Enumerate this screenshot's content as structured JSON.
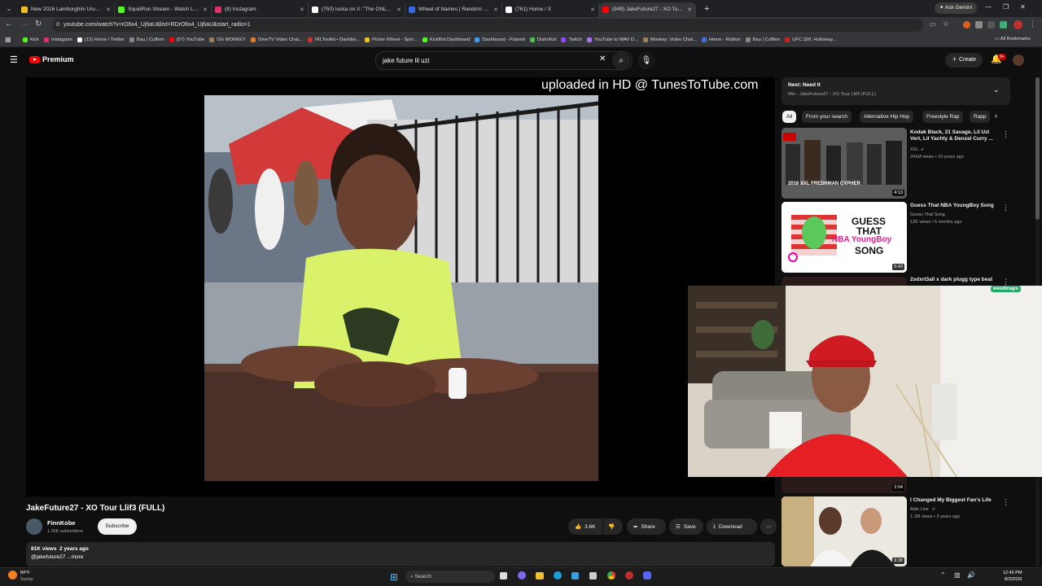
{
  "browser": {
    "tabs": [
      {
        "label": "New 2026 Lamborghini Urus S",
        "color": "#f0c020"
      },
      {
        "label": "SquidRon Stream - Watch Live",
        "color": "#53fc18"
      },
      {
        "label": "(8) Instagram",
        "color": "#e1306c"
      },
      {
        "label": "(750) lucka on X: \"The ONLY th",
        "color": "#ffffff"
      },
      {
        "label": "Wheel of Names | Random nam",
        "color": "#3369e8"
      },
      {
        "label": "(761) Home / X",
        "color": "#ffffff"
      },
      {
        "label": "(949) JakeFuture27 - XO Tour Ll",
        "color": "#ff0000"
      }
    ],
    "new_tab": "+",
    "ask_gemini": "Ask Gemini",
    "url": "youtube.com/watch?v=rO6x4_Uj6aU&list=RDrO6x4_Uj6aU&start_radio=1",
    "bookmarks": [
      {
        "label": "Kick",
        "color": "#53fc18"
      },
      {
        "label": "Instagram",
        "color": "#e1306c"
      },
      {
        "label": "(12) Home / Twitter",
        "color": "#ffffff"
      },
      {
        "label": "Bau | Cuffem",
        "color": "#888888"
      },
      {
        "label": "(57) YouTube",
        "color": "#ff0000"
      },
      {
        "label": "OG MONKEY",
        "color": "#a0805a"
      },
      {
        "label": "OmeTV Video Chat...",
        "color": "#e08030"
      },
      {
        "label": "IRLToolkit • Dashbo...",
        "color": "#cc3333"
      },
      {
        "label": "Picker Wheel - Spin...",
        "color": "#f0c020"
      },
      {
        "label": "KickBot Dashboard",
        "color": "#53fc18"
      },
      {
        "label": "Dashboard - Pulsoid",
        "color": "#40a0f0"
      },
      {
        "label": "DistroKid",
        "color": "#50c050"
      },
      {
        "label": "Twitch",
        "color": "#9146ff"
      },
      {
        "label": "YouTube to WAV D...",
        "color": "#b070f0"
      },
      {
        "label": "Monkey: Video Chat...",
        "color": "#a0805a"
      },
      {
        "label": "Home - Roblox",
        "color": "#4070e0"
      },
      {
        "label": "Bau | Cuffem",
        "color": "#888888"
      },
      {
        "label": "UFC 326: Holloway...",
        "color": "#d02020"
      }
    ],
    "all_bookmarks": "All Bookmarks"
  },
  "youtube": {
    "logo": "Premium",
    "search_value": "jake future lil uzi",
    "create": "Create",
    "notif_count": "9+",
    "overlay_text": "uploaded in HD @ TunesToTube.com",
    "video_title": "JakeFuture27 - XO Tour Llif3 (FULL)",
    "channel": "FinnKobe",
    "subscribers": "1.26K subscribers",
    "subscribe": "Subscribe",
    "likes": "3.6K",
    "share": "Share",
    "save": "Save",
    "download": "Download",
    "views": "81K views  2 years ago",
    "desc": "@jakefuture27 ...more",
    "next_label": "Next: Need It",
    "next_sub": "Mix - JakeFuture27 - XO Tour Llif3 (FULL)",
    "chips": [
      "All",
      "From your search",
      "Alternative Hip Hop",
      "Freestyle Rap",
      "Rapp"
    ],
    "recs": [
      {
        "title": "Kodak Black, 21 Savage, Lil Uzi Vert, Lil Yachty & Denzel Curry ...",
        "channel": "XXL",
        "meta": "241M views • 10 years ago",
        "duration": "4:13",
        "thumb_text": "2016 XXL FRESHMAN CYPHER"
      },
      {
        "title": "Guess That NBA YoungBoy Song",
        "channel": "Guess That Song",
        "meta": "12K views • 5 months ago",
        "duration": "5:43",
        "thumb_text_1": "GUESS",
        "thumb_text_2": "THAT",
        "thumb_text_3": "NBA YoungBoy",
        "thumb_text_4": "SONG"
      },
      {
        "title": "2sdxrt3all x dark plugg type beat",
        "channel": "",
        "meta": "",
        "duration": "2:04"
      },
      {
        "title": "I Changed My Biggest Fan's Life",
        "channel": "Adin Live",
        "meta": "1.1M views • 3 years ago",
        "duration": "9:38"
      }
    ],
    "webcam_badge": "weedmaps"
  },
  "taskbar": {
    "weather_temp": "84°F",
    "weather_desc": "Sunny",
    "search": "Search",
    "time": "12:45 PM",
    "date": "8/2/2026"
  }
}
